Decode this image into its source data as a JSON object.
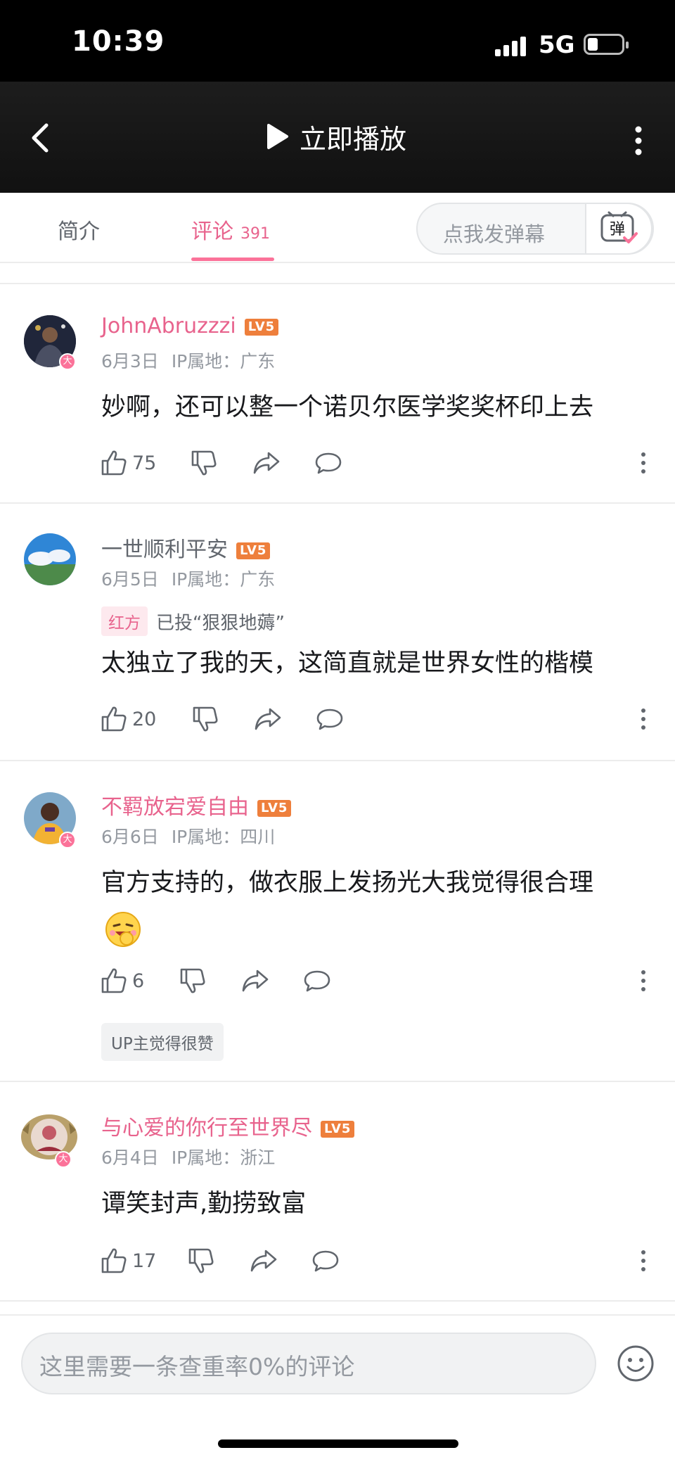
{
  "status_bar": {
    "time": "10:39",
    "network": "5G"
  },
  "header": {
    "play_label": "立即播放"
  },
  "tabs": {
    "intro": "简介",
    "comments": "评论",
    "comment_count": "391",
    "danmaku_placeholder": "点我发弹幕",
    "danmaku_icon_text": "弹"
  },
  "comments": [
    {
      "username": "JohnAbruzzzi",
      "level": "LV5",
      "date": "6月3日",
      "ip": "IP属地：广东",
      "text": "妙啊，还可以整一个诺贝尔医学奖奖杯印上去",
      "likes": "75"
    },
    {
      "username": "一世顺利平安",
      "level": "LV5",
      "date": "6月5日",
      "ip": "IP属地：广东",
      "vote_tag": "红方",
      "vote_text": "已投“狠狠地薅”",
      "text": "太独立了我的天，这简直就是世界女性的楷模",
      "likes": "20"
    },
    {
      "username": "不羁放宕爱自由",
      "level": "LV5",
      "date": "6月6日",
      "ip": "IP属地：四川",
      "text": "官方支持的，做衣服上发扬光大我觉得很合理",
      "likes": "6",
      "up_badge": "UP主觉得很赞"
    },
    {
      "username": "与心爱的你行至世界尽",
      "level": "LV5",
      "date": "6月4日",
      "ip": "IP属地：浙江",
      "text": "谭笑封声,勤捞致富",
      "likes": "17"
    }
  ],
  "composer": {
    "placeholder": "这里需要一条查重率0%的评论"
  },
  "colors": {
    "accent": "#fb7299",
    "level_badge": "#ee7f3c",
    "header_bg": "#151515"
  }
}
